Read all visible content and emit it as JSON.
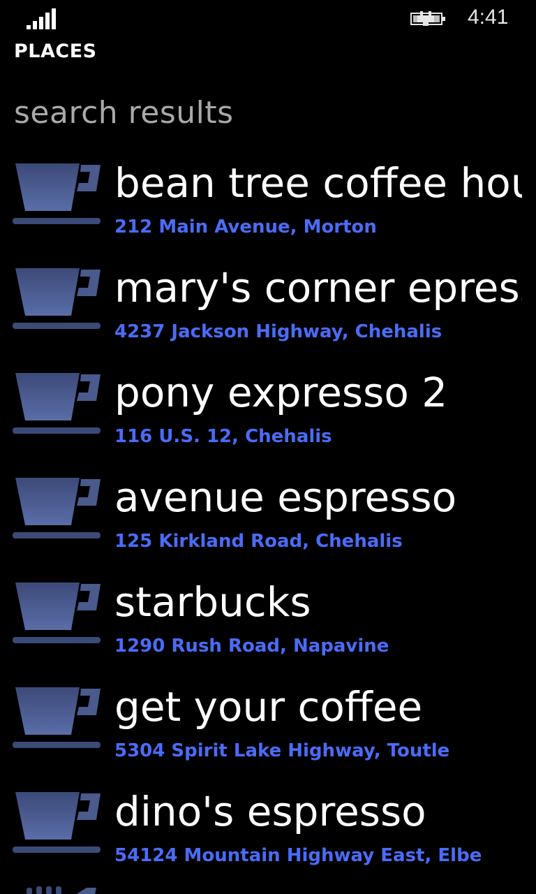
{
  "status_bar": {
    "time": "4:41",
    "signal_icon": "signal-strength-icon",
    "battery_icon": "battery-charging-icon"
  },
  "app": {
    "title": "PLACES"
  },
  "page": {
    "header": "search results"
  },
  "colors": {
    "background": "#000000",
    "address": "#4a6cf7",
    "cup_icon": "#3a4a78",
    "header": "#a9a9a9"
  },
  "results": [
    {
      "name": "bean tree coffee house",
      "address": "212 Main Avenue, Morton",
      "icon": "coffee-cup-icon"
    },
    {
      "name": "mary's corner epresso",
      "address": "4237 Jackson Highway, Chehalis",
      "icon": "coffee-cup-icon"
    },
    {
      "name": "pony expresso 2",
      "address": "116 U.S. 12, Chehalis",
      "icon": "coffee-cup-icon"
    },
    {
      "name": "avenue espresso",
      "address": "125 Kirkland Road, Chehalis",
      "icon": "coffee-cup-icon"
    },
    {
      "name": "starbucks",
      "address": "1290 Rush Road, Napavine",
      "icon": "coffee-cup-icon"
    },
    {
      "name": "get your coffee",
      "address": "5304 Spirit Lake Highway, Toutle",
      "icon": "coffee-cup-icon"
    },
    {
      "name": "dino's espresso",
      "address": "54124 Mountain Highway East, Elbe",
      "icon": "coffee-cup-icon"
    }
  ]
}
